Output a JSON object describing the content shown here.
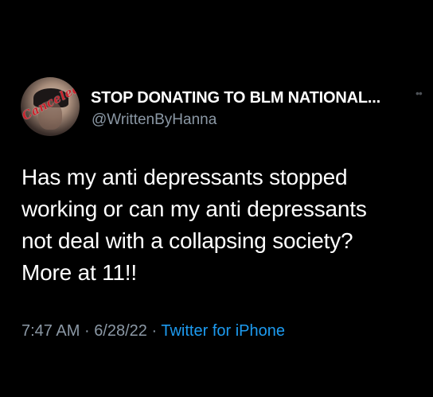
{
  "author": {
    "display_name": "STOP DONATING TO BLM NATIONAL...",
    "handle": "@WrittenByHanna",
    "avatar_stamp": "Canceled"
  },
  "tweet": {
    "lines": [
      "Has my anti depressants stopped",
      "working or can my anti depressants",
      "not deal with a collapsing society?",
      "More at 11!!"
    ],
    "time": "7:47 AM",
    "date": "6/28/22",
    "separator": "·",
    "source": "Twitter for iPhone"
  },
  "icons": {
    "more": "more-options-icon"
  },
  "colors": {
    "background": "#000000",
    "text": "#ffffff",
    "secondary": "#8b98a5",
    "link": "#1d9bf0",
    "stamp": "#c8232c"
  }
}
